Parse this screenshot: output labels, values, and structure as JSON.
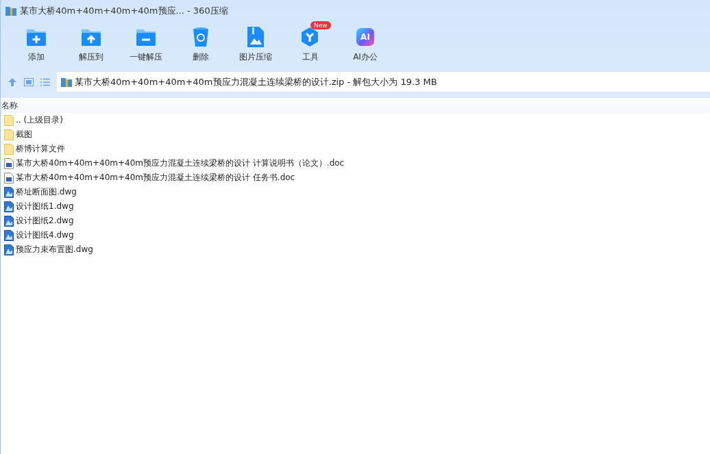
{
  "window": {
    "title": "某市大桥40m+40m+40m+40m预应... - 360压缩"
  },
  "toolbar": [
    {
      "kind": "add",
      "label": "添加"
    },
    {
      "kind": "extract",
      "label": "解压到"
    },
    {
      "kind": "oneclick",
      "label": "一键解压"
    },
    {
      "kind": "delete",
      "label": "删除"
    },
    {
      "kind": "image",
      "label": "图片压缩"
    },
    {
      "kind": "tools",
      "label": "工具",
      "badge": "New"
    },
    {
      "kind": "ai",
      "label": "AI办公",
      "icon_text": "AI"
    }
  ],
  "address": {
    "path": "某市大桥40m+40m+40m+40m预应力混凝土连续梁桥的设计.zip - 解包大小为 19.3 MB"
  },
  "table": {
    "columns": [
      "名称"
    ],
    "rows": [
      {
        "kind": "folder",
        "name": ".. (上级目录)"
      },
      {
        "kind": "folder",
        "name": "截图"
      },
      {
        "kind": "folder",
        "name": "桥博计算文件"
      },
      {
        "kind": "doc",
        "name": "某市大桥40m+40m+40m+40m预应力混凝土连续梁桥的设计 计算说明书（论文）.doc"
      },
      {
        "kind": "doc",
        "name": "某市大桥40m+40m+40m+40m预应力混凝土连续梁桥的设计 任务书.doc"
      },
      {
        "kind": "dwg",
        "name": "桥址断面图.dwg"
      },
      {
        "kind": "dwg",
        "name": "设计图纸1.dwg"
      },
      {
        "kind": "dwg",
        "name": "设计图纸2.dwg"
      },
      {
        "kind": "dwg",
        "name": "设计图纸4.dwg"
      },
      {
        "kind": "dwg",
        "name": "预应力束布置图.dwg"
      }
    ]
  }
}
